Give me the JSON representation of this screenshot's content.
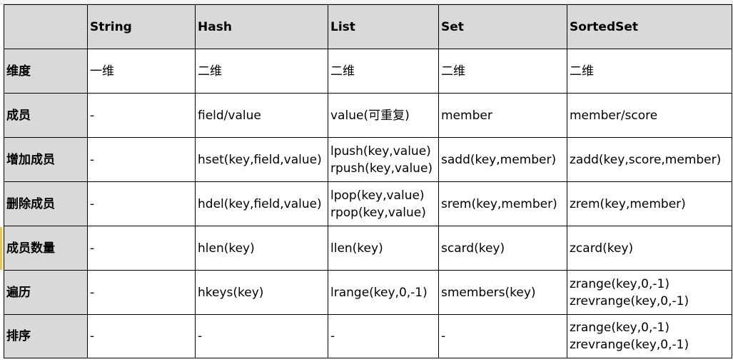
{
  "table": {
    "headers": [
      "",
      "String",
      "Hash",
      "List",
      "Set",
      "SortedSet"
    ],
    "rows": [
      {
        "label": "维度",
        "cells": [
          [
            "一维"
          ],
          [
            "二维"
          ],
          [
            "二维"
          ],
          [
            "二维"
          ],
          [
            "二维"
          ]
        ]
      },
      {
        "label": "成员",
        "cells": [
          [
            "-"
          ],
          [
            "field/value"
          ],
          [
            "value(可重复)"
          ],
          [
            "member"
          ],
          [
            "member/score"
          ]
        ]
      },
      {
        "label": "增加成员",
        "cells": [
          [
            "-"
          ],
          [
            "hset(key,field,value)"
          ],
          [
            "lpush(key,value)",
            "rpush(key,value)"
          ],
          [
            "sadd(key,member)"
          ],
          [
            "zadd(key,score,member)"
          ]
        ]
      },
      {
        "label": "删除成员",
        "cells": [
          [
            "-"
          ],
          [
            "hdel(key,field,value)"
          ],
          [
            "lpop(key,value)",
            "rpop(key,value)"
          ],
          [
            "srem(key,member)"
          ],
          [
            "zrem(key,member)"
          ]
        ]
      },
      {
        "label": "成员数量",
        "cells": [
          [
            "-"
          ],
          [
            "hlen(key)"
          ],
          [
            "llen(key)"
          ],
          [
            "scard(key)"
          ],
          [
            "zcard(key)"
          ]
        ]
      },
      {
        "label": "遍历",
        "cells": [
          [
            "-"
          ],
          [
            "hkeys(key)"
          ],
          [
            "lrange(key,0,-1)"
          ],
          [
            "smembers(key)"
          ],
          [
            "zrange(key,0,-1)",
            "zrevrange(key,0,-1)"
          ]
        ]
      },
      {
        "label": "排序",
        "cells": [
          [
            "-"
          ],
          [
            "-"
          ],
          [
            "-"
          ],
          [
            "-"
          ],
          [
            "zrange(key,0,-1)",
            "zrevrange(key,0,-1)"
          ]
        ]
      }
    ]
  },
  "colors": {
    "header_fill": "#d9d9d9",
    "grid": "#000000",
    "active_row_marker": "#f2c24f"
  }
}
